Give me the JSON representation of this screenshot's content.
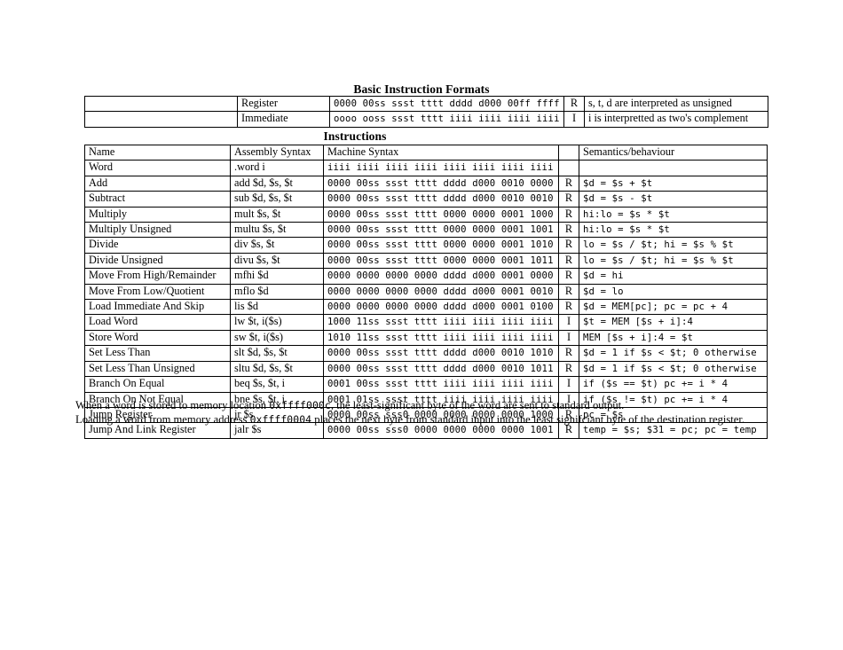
{
  "document": {
    "formats_heading": "Basic Instruction Formats",
    "instructions_heading": "Instructions"
  },
  "formats_table": {
    "rows": [
      {
        "blank": "",
        "kind": "Register",
        "machine": "0000 00ss ssst tttt dddd d000 00ff ffff",
        "type": "R",
        "semantics": "s, t, d are interpreted as unsigned"
      },
      {
        "blank": "",
        "kind": "Immediate",
        "machine": "oooo ooss ssst tttt iiii iiii iiii iiii",
        "type": "I",
        "semantics": "i is interpretted as two's complement"
      }
    ]
  },
  "instructions_table": {
    "headers": {
      "name": "Name",
      "assembly": "Assembly Syntax",
      "machine": "Machine Syntax",
      "type": "",
      "semantics": "Semantics/behaviour"
    },
    "rows": [
      {
        "name": "Word",
        "assembly": ".word i",
        "machine": "iiii iiii iiii iiii iiii iiii iiii iiii",
        "type": "",
        "semantics": ""
      },
      {
        "name": "Add",
        "assembly": "add $d, $s, $t",
        "machine": "0000 00ss ssst tttt dddd d000 0010 0000",
        "type": "R",
        "semantics": "$d = $s + $t"
      },
      {
        "name": "Subtract",
        "assembly": "sub $d, $s, $t",
        "machine": "0000 00ss ssst tttt dddd d000 0010 0010",
        "type": "R",
        "semantics": "$d = $s - $t"
      },
      {
        "name": "Multiply",
        "assembly": "mult $s, $t",
        "machine": "0000 00ss ssst tttt 0000 0000 0001 1000",
        "type": "R",
        "semantics": "hi:lo = $s * $t"
      },
      {
        "name": "Multiply Unsigned",
        "assembly": "multu $s, $t",
        "machine": "0000 00ss ssst tttt 0000 0000 0001 1001",
        "type": "R",
        "semantics": "hi:lo = $s * $t"
      },
      {
        "name": "Divide",
        "assembly": "div $s, $t",
        "machine": "0000 00ss ssst tttt 0000 0000 0001 1010",
        "type": "R",
        "semantics": "lo = $s / $t; hi = $s % $t"
      },
      {
        "name": "Divide Unsigned",
        "assembly": "divu $s, $t",
        "machine": "0000 00ss ssst tttt 0000 0000 0001 1011",
        "type": "R",
        "semantics": "lo = $s / $t; hi = $s % $t"
      },
      {
        "name": "Move From High/Remainder",
        "assembly": "mfhi $d",
        "machine": "0000 0000 0000 0000 dddd d000 0001 0000",
        "type": "R",
        "semantics": "$d = hi"
      },
      {
        "name": "Move From Low/Quotient",
        "assembly": "mflo $d",
        "machine": "0000 0000 0000 0000 dddd d000 0001 0010",
        "type": "R",
        "semantics": "$d = lo"
      },
      {
        "name": "Load Immediate And Skip",
        "assembly": "lis $d",
        "machine": "0000 0000 0000 0000 dddd d000 0001 0100",
        "type": "R",
        "semantics": "$d = MEM[pc]; pc = pc + 4"
      },
      {
        "name": "Load Word",
        "assembly": "lw $t, i($s)",
        "machine": "1000 11ss ssst tttt iiii iiii iiii iiii",
        "type": "I",
        "semantics": "$t = MEM [$s + i]:4"
      },
      {
        "name": "Store Word",
        "assembly": "sw $t, i($s)",
        "machine": "1010 11ss ssst tttt iiii iiii iiii iiii",
        "type": "I",
        "semantics": "MEM [$s + i]:4 = $t"
      },
      {
        "name": "Set Less Than",
        "assembly": "slt $d, $s, $t",
        "machine": "0000 00ss ssst tttt dddd d000 0010 1010",
        "type": "R",
        "semantics": "$d = 1 if $s < $t; 0 otherwise"
      },
      {
        "name": "Set Less Than Unsigned",
        "assembly": "sltu $d, $s, $t",
        "machine": "0000 00ss ssst tttt dddd d000 0010 1011",
        "type": "R",
        "semantics": "$d = 1 if $s < $t; 0 otherwise"
      },
      {
        "name": "Branch On Equal",
        "assembly": "beq $s, $t, i",
        "machine": "0001 00ss ssst tttt iiii iiii iiii iiii",
        "type": "I",
        "semantics": "if ($s == $t) pc += i * 4"
      },
      {
        "name": "Branch On Not Equal",
        "assembly": "bne $s, $t, i",
        "machine": "0001 01ss ssst tttt iiii iiii iiii iiii",
        "type": "I",
        "semantics": "if ($s != $t) pc += i * 4"
      },
      {
        "name": "Jump Register",
        "assembly": "jr $s",
        "machine": "0000 00ss sss0 0000 0000 0000 0000 1000",
        "type": "R",
        "semantics": "pc = $s"
      },
      {
        "name": "Jump And Link Register",
        "assembly": "jalr $s",
        "machine": "0000 00ss sss0 0000 0000 0000 0000 1001",
        "type": "R",
        "semantics": "temp = $s; $31 = pc; pc = temp"
      }
    ]
  },
  "notes": {
    "line1_part1": "When a word is stored to memory location ",
    "line1_address": "0xffff000c",
    "line1_part2": ", the least-significant byte of the word are sent to standard output.",
    "line2_part1": "Loading a word from memory address ",
    "line2_address": "0xffff0004",
    "line2_part2": " places the next byte from standard input into the least signifciant byte of the destination register."
  }
}
